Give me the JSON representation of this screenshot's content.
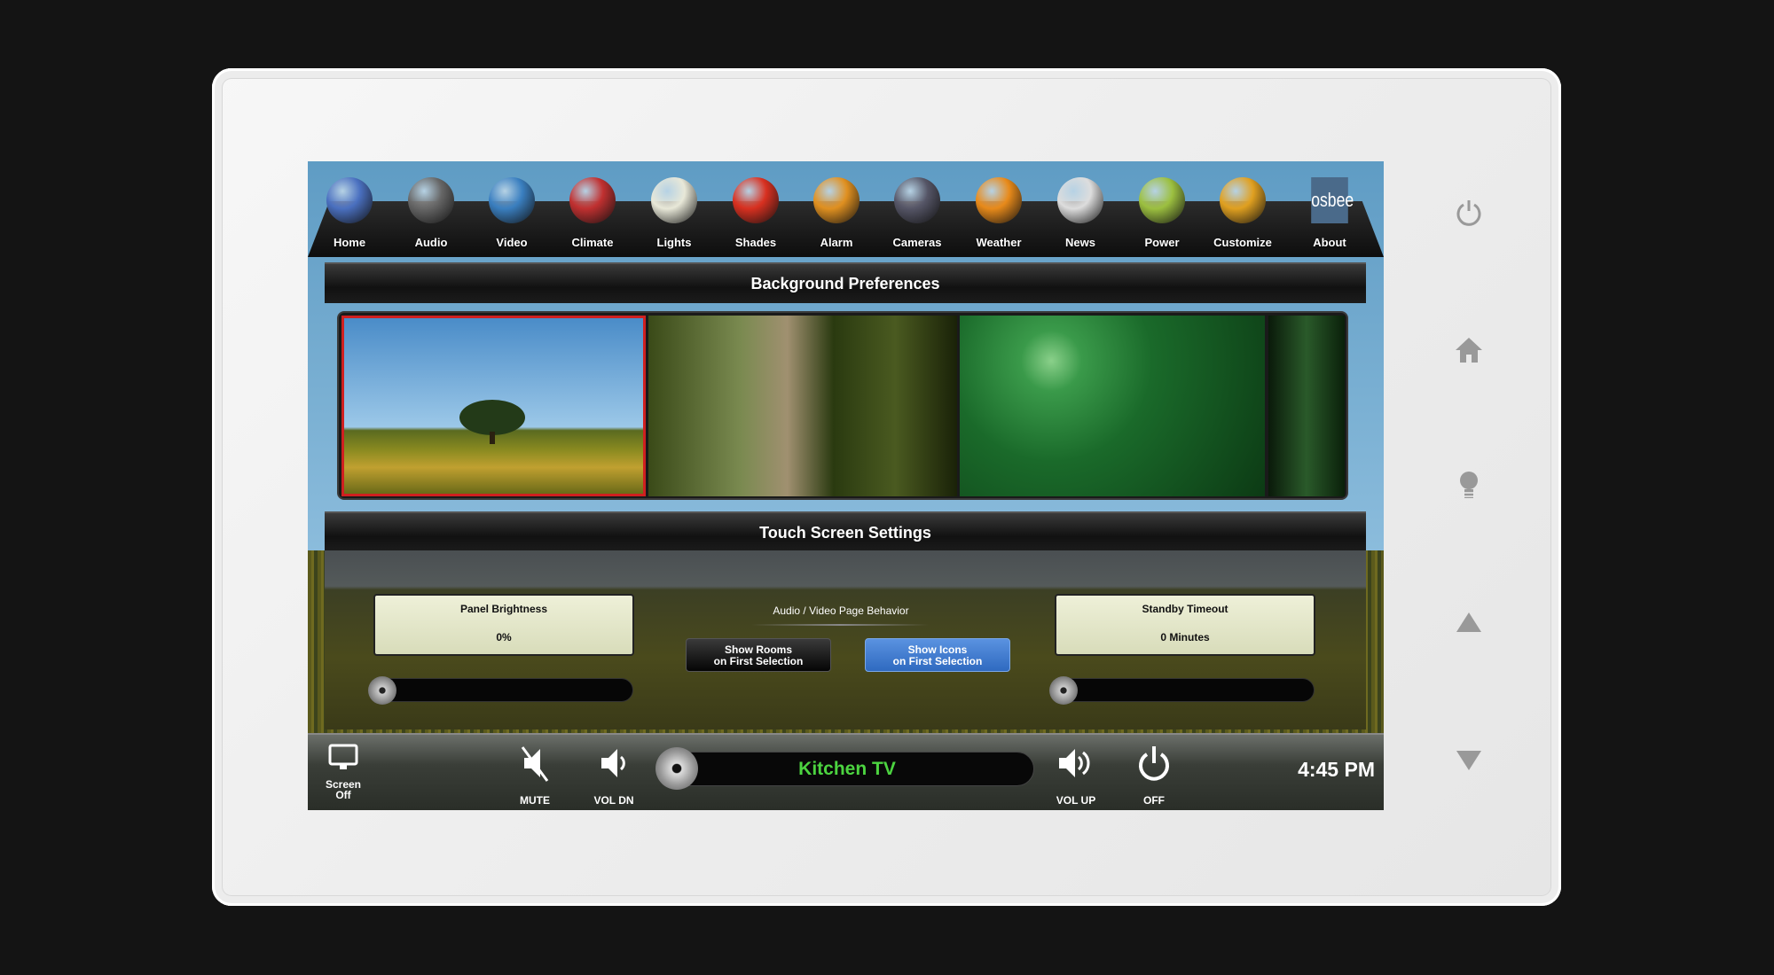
{
  "nav": {
    "items": [
      {
        "label": "Home",
        "icon": "home-icon",
        "color": "#4a70c0"
      },
      {
        "label": "Audio",
        "icon": "speaker-icon",
        "color": "#666"
      },
      {
        "label": "Video",
        "icon": "film-reel-icon",
        "color": "#3a7fc0"
      },
      {
        "label": "Climate",
        "icon": "thermometer-icon",
        "color": "#c03030"
      },
      {
        "label": "Lights",
        "icon": "lightbulb-icon",
        "color": "#e8e8d8"
      },
      {
        "label": "Shades",
        "icon": "window-shade-icon",
        "color": "#d83020"
      },
      {
        "label": "Alarm",
        "icon": "padlock-icon",
        "color": "#e09020"
      },
      {
        "label": "Cameras",
        "icon": "security-camera-icon",
        "color": "#556"
      },
      {
        "label": "Weather",
        "icon": "sun-icon",
        "color": "#e88a1a"
      },
      {
        "label": "News",
        "icon": "newspaper-icon",
        "color": "#ddd"
      },
      {
        "label": "Power",
        "icon": "globe-icon",
        "color": "#9cc040"
      },
      {
        "label": "Customize",
        "icon": "photos-icon",
        "color": "#e0a020"
      },
      {
        "label": "About",
        "icon": "osbee-logo",
        "color": "#4a6a8a",
        "logo_text": "osbee"
      }
    ]
  },
  "background_preferences": {
    "title": "Background Preferences",
    "selected_index": 0,
    "thumbnails": [
      "tree-sunflower-field",
      "vineyard-grapes",
      "spider-green-bokeh",
      "dark-leaf"
    ]
  },
  "touch_screen_settings": {
    "title": "Touch Screen Settings",
    "panel_brightness": {
      "label": "Panel Brightness",
      "value": "0%",
      "level": 0
    },
    "av_behavior": {
      "label": "Audio / Video Page Behavior",
      "options": [
        "Show Rooms\non First Selection",
        "Show Icons\non First Selection"
      ],
      "option_lines": [
        [
          "Show Rooms",
          "on First Selection"
        ],
        [
          "Show Icons",
          "on First Selection"
        ]
      ],
      "selected_index": 1
    },
    "standby_timeout": {
      "label": "Standby Timeout",
      "value": "0 Minutes",
      "level": 0
    }
  },
  "bottom": {
    "screen_off": [
      "Screen",
      "Off"
    ],
    "mute": "MUTE",
    "vol_dn": "VOL DN",
    "source": "Kitchen TV",
    "vol_up": "VOL UP",
    "off": "OFF",
    "time": "4:45 PM"
  },
  "colors": {
    "selected_border": "#d02020",
    "active_button": "#3b78d0",
    "source_text": "#4cd440"
  },
  "side_buttons": [
    "power-icon",
    "home-icon",
    "lightbulb-icon",
    "arrow-up-icon",
    "arrow-down-icon"
  ]
}
